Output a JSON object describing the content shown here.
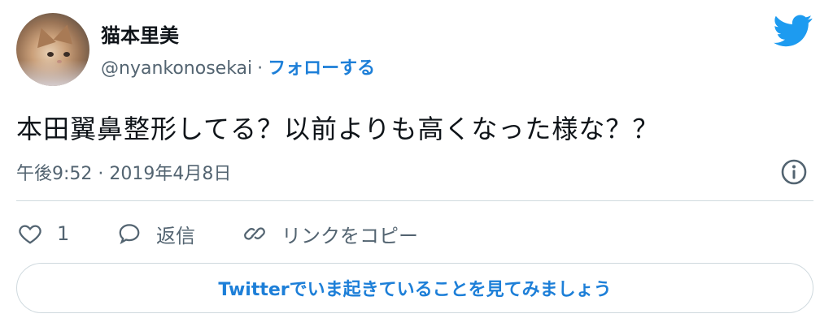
{
  "author": {
    "display_name": "猫本里美",
    "handle": "@nyankonosekai",
    "separator": "·",
    "follow_label": "フォローする"
  },
  "tweet": {
    "text": "本田翼鼻整形してる？以前よりも高くなった様な？？",
    "timestamp": "午後9:52 · 2019年4月8日"
  },
  "actions": {
    "like_count": "1",
    "reply_label": "返信",
    "copy_link_label": "リンクをコピー"
  },
  "cta": {
    "label": "Twitterでいま起きていることを見てみましょう"
  },
  "icons": {
    "brand": "twitter-bird-icon",
    "info": "info-icon",
    "like": "heart-icon",
    "reply": "speech-bubble-icon",
    "copy": "link-icon"
  },
  "colors": {
    "brand_blue": "#1d9bf0",
    "link_blue": "#1d7fd8",
    "muted_text": "#536471",
    "border": "#cfd9de"
  }
}
